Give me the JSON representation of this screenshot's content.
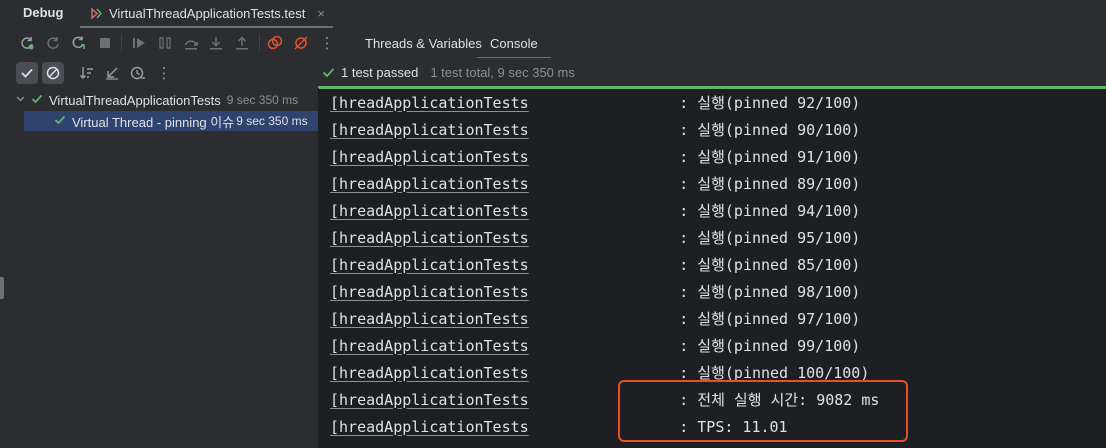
{
  "top": {
    "debug_label": "Debug",
    "run_tab_label": "VirtualThreadApplicationTests.test",
    "close_glyph": "×"
  },
  "toolbar": {
    "tabs": [
      {
        "label": "Threads & Variables",
        "active": false
      },
      {
        "label": "Console",
        "active": true
      }
    ],
    "more_glyph": "⋮"
  },
  "status": {
    "passed_text": "1 test passed",
    "total_text": "1 test total, 9 sec 350 ms"
  },
  "tree": {
    "root": {
      "label": "VirtualThreadApplicationTests",
      "duration": "9 sec 350 ms"
    },
    "child": {
      "label": "Virtual Thread - pinning 이슈",
      "duration": "9 sec 350 ms"
    }
  },
  "console": {
    "lines": [
      {
        "cls": "[hreadApplicationTests",
        "msg": "       : 실행(pinned 92/100)"
      },
      {
        "cls": "[hreadApplicationTests",
        "msg": "       : 실행(pinned 90/100)"
      },
      {
        "cls": "[hreadApplicationTests",
        "msg": "       : 실행(pinned 91/100)"
      },
      {
        "cls": "[hreadApplicationTests",
        "msg": "       : 실행(pinned 89/100)"
      },
      {
        "cls": "[hreadApplicationTests",
        "msg": "       : 실행(pinned 94/100)"
      },
      {
        "cls": "[hreadApplicationTests",
        "msg": "       : 실행(pinned 95/100)"
      },
      {
        "cls": "[hreadApplicationTests",
        "msg": "       : 실행(pinned 85/100)"
      },
      {
        "cls": "[hreadApplicationTests",
        "msg": "       : 실행(pinned 98/100)"
      },
      {
        "cls": "[hreadApplicationTests",
        "msg": "       : 실행(pinned 97/100)"
      },
      {
        "cls": "[hreadApplicationTests",
        "msg": "       : 실행(pinned 99/100)"
      },
      {
        "cls": "[hreadApplicationTests",
        "msg": "       : 실행(pinned 100/100)"
      },
      {
        "cls": "[hreadApplicationTests",
        "msg": "       : 전체 실행 시간: 9082 ms"
      },
      {
        "cls": "[hreadApplicationTests",
        "msg": "       : TPS: 11.01"
      }
    ]
  },
  "colors": {
    "accent": "#3574f0",
    "success": "#5fb865",
    "highlight": "#e4502b"
  }
}
